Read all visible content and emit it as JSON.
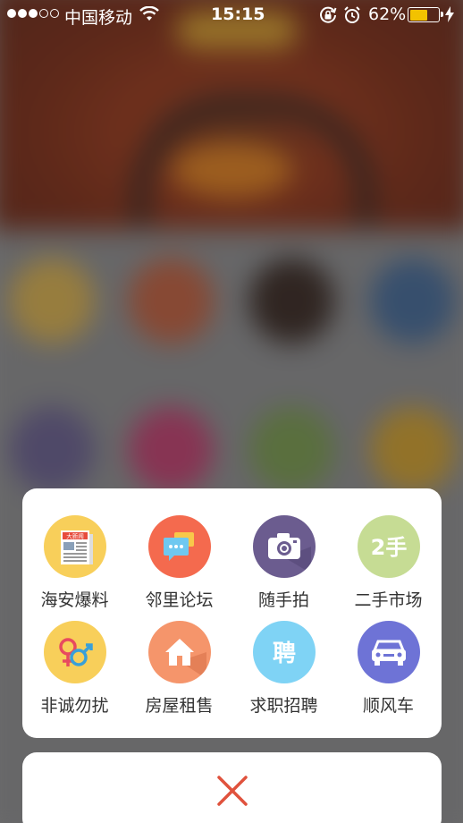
{
  "status_bar": {
    "carrier": "中国移动",
    "time": "15:15",
    "battery_percent": "62%",
    "battery_level": 0.62,
    "icons": [
      "signal-dots",
      "wifi-icon",
      "rotation-lock-icon",
      "alarm-icon",
      "battery-icon",
      "charging-bolt-icon"
    ]
  },
  "menu": {
    "items": [
      {
        "label": "海安爆料",
        "icon": "newspaper-icon",
        "color": "#f8cf5a"
      },
      {
        "label": "邻里论坛",
        "icon": "chat-bubbles-icon",
        "color": "#f46a4e"
      },
      {
        "label": "随手拍",
        "icon": "camera-icon",
        "color": "#6b5c8f"
      },
      {
        "label": "二手市场",
        "icon": "second-hand-icon",
        "color": "#c6dc94"
      },
      {
        "label": "非诚勿扰",
        "icon": "gender-symbols-icon",
        "color": "#f8cf5a"
      },
      {
        "label": "房屋租售",
        "icon": "house-icon",
        "color": "#f5956b"
      },
      {
        "label": "求职招聘",
        "icon": "hire-icon",
        "color": "#7fd3f5"
      },
      {
        "label": "顺风车",
        "icon": "car-icon",
        "color": "#6e73d6"
      }
    ],
    "icon_text": {
      "newspaper": "大新闻",
      "second_hand": "2手",
      "hire": "聘"
    }
  },
  "close": {
    "icon": "close-icon",
    "color": "#e0523d"
  }
}
